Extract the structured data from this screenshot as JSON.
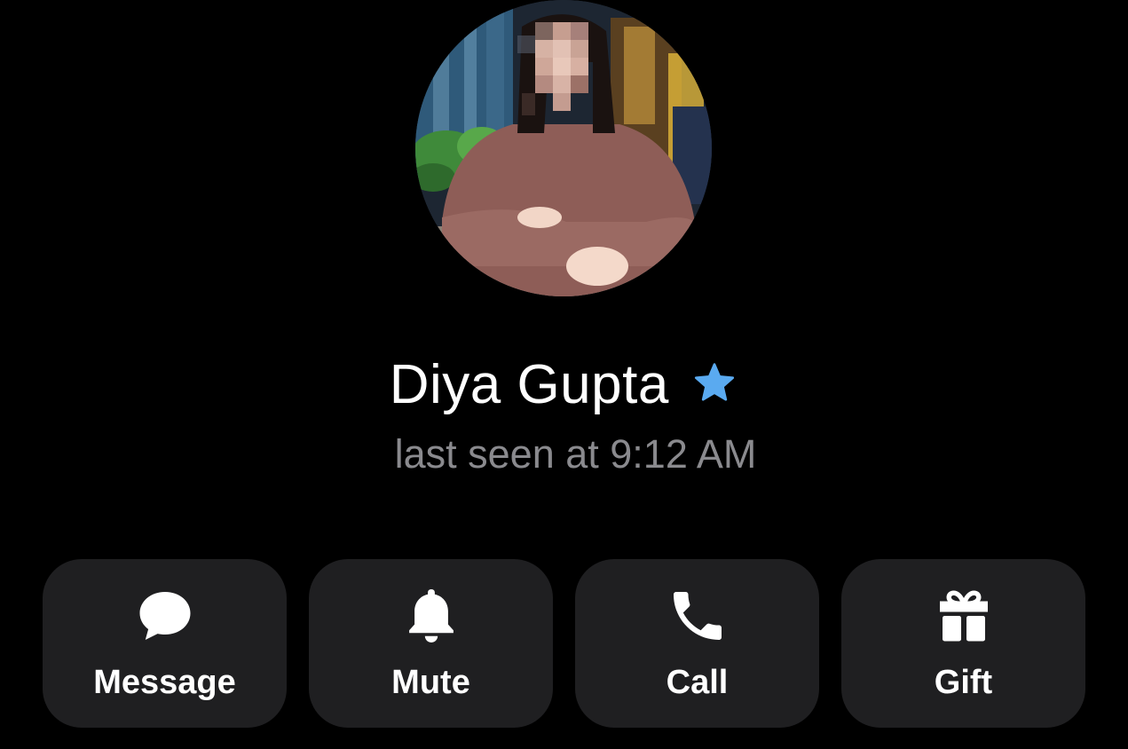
{
  "profile": {
    "name": "Diya Gupta",
    "status": "last seen at 9:12 AM",
    "avatar_alt": "profile photo",
    "badge_icon": "star-icon",
    "badge_color": "#5aaaf0"
  },
  "actions": [
    {
      "label": "Message",
      "icon": "chat-bubble-icon"
    },
    {
      "label": "Mute",
      "icon": "bell-icon"
    },
    {
      "label": "Call",
      "icon": "phone-icon"
    },
    {
      "label": "Gift",
      "icon": "gift-icon"
    }
  ],
  "theme": {
    "background": "#000000",
    "button_bg": "#1f1f21",
    "status_text": "#8a8a8e"
  }
}
